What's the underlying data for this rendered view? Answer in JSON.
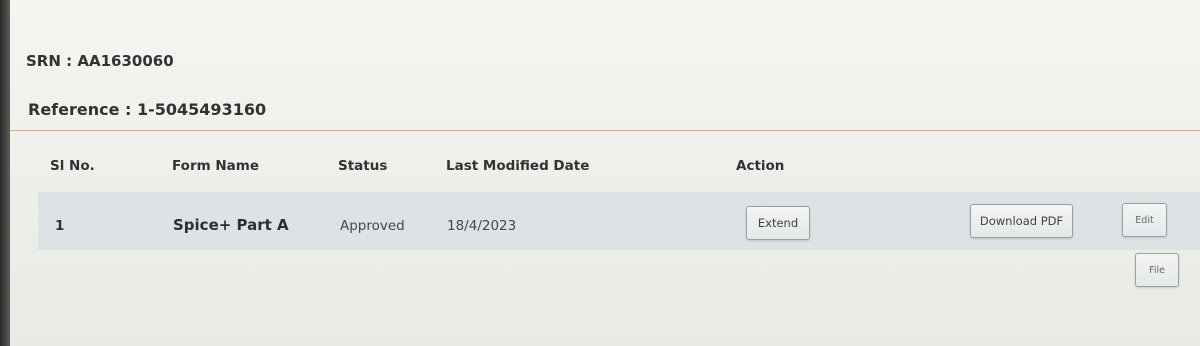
{
  "header": {
    "srn": "SRN : AA1630060",
    "reference": "Reference : 1-5045493160"
  },
  "table": {
    "columns": [
      "Sl No.",
      "Form Name",
      "Status",
      "Last Modified Date",
      "Action"
    ],
    "rows": [
      {
        "sl_no": "1",
        "form_name": "Spice+ Part A",
        "status": "Approved",
        "last_modified": "18/4/2023",
        "actions": {
          "extend": "Extend",
          "download_pdf": "Download PDF",
          "edit": "Edit",
          "file": "File"
        }
      }
    ]
  }
}
